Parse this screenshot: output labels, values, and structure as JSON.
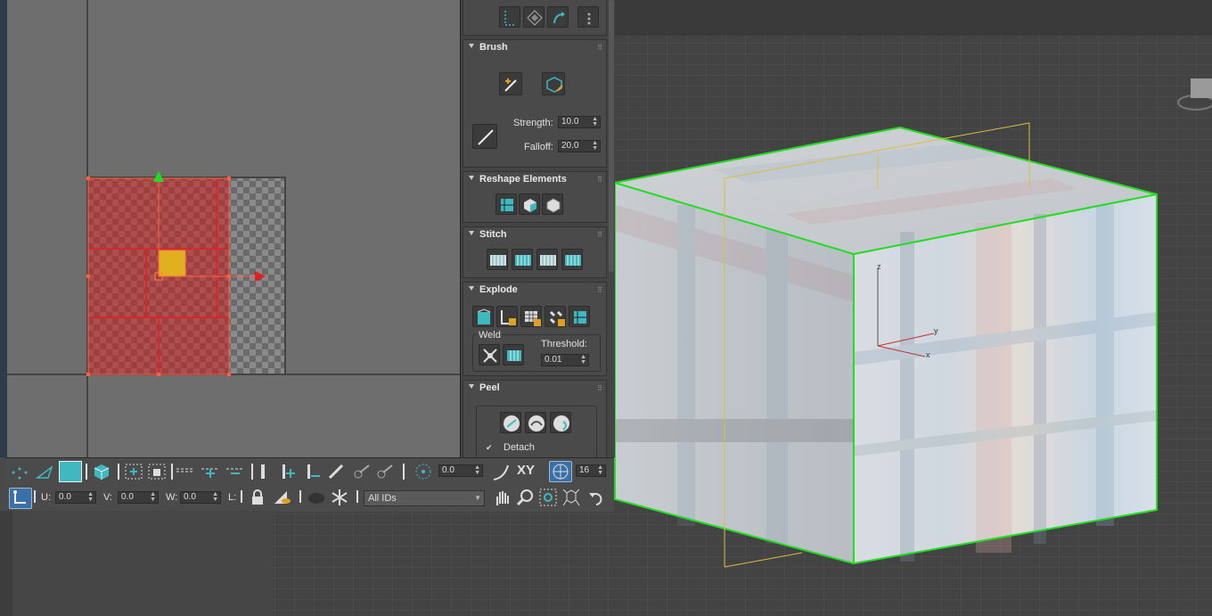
{
  "brush": {
    "title": "Brush",
    "strength_label": "Strength:",
    "strength_value": "10.0",
    "falloff_label": "Falloff:",
    "falloff_value": "20.0"
  },
  "reshape": {
    "title": "Reshape Elements"
  },
  "stitch": {
    "title": "Stitch"
  },
  "explode": {
    "title": "Explode",
    "weld_label": "Weld",
    "threshold_label": "Threshold:",
    "threshold_value": "0.01"
  },
  "peel": {
    "title": "Peel",
    "detach_label": "Detach"
  },
  "toolbar": {
    "rotate_value": "0.0",
    "xy_label": "XY",
    "grid_value": "16",
    "u_label": "U:",
    "u_value": "0.0",
    "v_label": "V:",
    "v_value": "0.0",
    "w_label": "W:",
    "w_value": "0.0",
    "l_label": "L:",
    "ids_select": "All IDs"
  },
  "viewport": {
    "axis_z": "z",
    "axis_y": "y",
    "axis_x": "x"
  },
  "colors": {
    "selection_green": "#22dd22",
    "uv_selected": "#b03030",
    "accent": "#3fb8c0"
  },
  "icons": [
    "brush-move-icon",
    "brush-relax-icon",
    "brush-stroke-icon",
    "reshape-straighten-icon",
    "stitch-icon",
    "explode-icon",
    "weld-icon",
    "peel-icon",
    "lock-icon",
    "snowflake-icon",
    "pan-hand-icon",
    "zoom-icon"
  ]
}
